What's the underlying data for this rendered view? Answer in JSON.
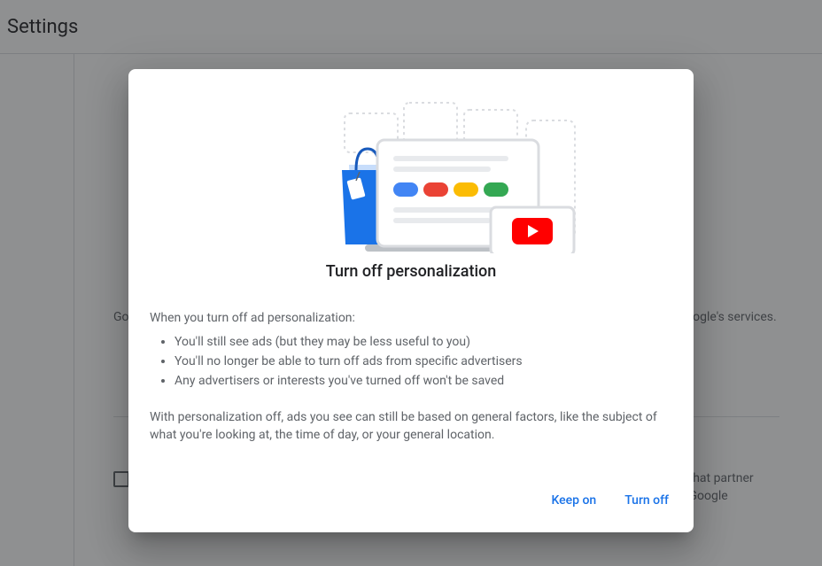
{
  "header": {
    "title": "Settings"
  },
  "background": {
    "paragraph1": "Google makes ads more useful based on your activity on Google and partner websites & apps that use Google's services.",
    "checkbox_text": "Also use your activity & information from Google services to personalize ads on websites and apps that partner with Google to show ads. This stores data from websites and apps that partner with Google in your Google Account."
  },
  "dialog": {
    "title": "Turn off personalization",
    "intro": "When you turn off ad personalization:",
    "bullets": [
      "You'll still see ads (but they may be less useful to you)",
      "You'll no longer be able to turn off ads from specific advertisers",
      "Any advertisers or interests you've turned off won't be saved"
    ],
    "footnote": "With personalization off, ads you see can still be based on general factors, like the subject of what you're looking at, the time of day, or your general location.",
    "keep_on_label": "Keep on",
    "turn_off_label": "Turn off"
  }
}
